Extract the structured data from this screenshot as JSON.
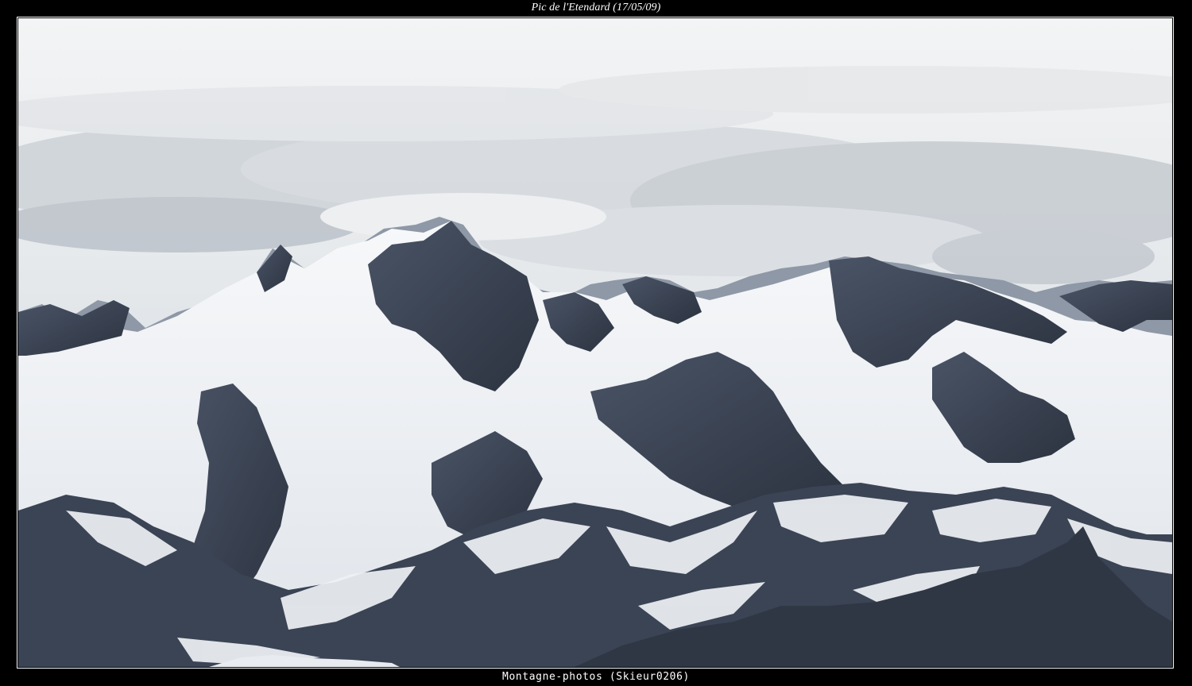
{
  "photo": {
    "caption_top": "Pic de l'Etendard (17/05/09)",
    "caption_bottom": "Montagne-photos (Skieur0206)"
  },
  "colors": {
    "frame": "#000000",
    "border": "#ffffff",
    "sky_light": "#eef1f3",
    "cloud_grey": "#c9ced3",
    "snow": "#f4f6f8",
    "rock_dark": "#3a4352",
    "rock_mid": "#6c7686"
  }
}
